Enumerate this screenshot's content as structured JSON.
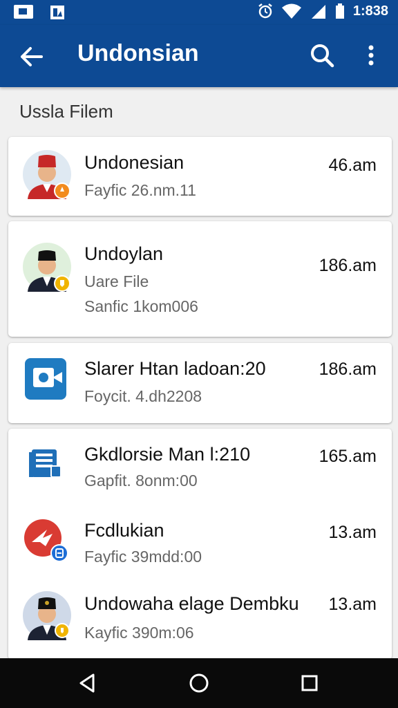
{
  "status_bar": {
    "time": "1:838",
    "icons": [
      "photo-icon",
      "gallery-icon",
      "alarm-icon",
      "wifi-icon",
      "signal-icon",
      "battery-icon"
    ]
  },
  "app_bar": {
    "title": "Undonsian",
    "icons": [
      "back-arrow-icon",
      "search-icon",
      "more-vert-icon"
    ],
    "color": "#0d4a94"
  },
  "section": {
    "header": "Ussla Filem"
  },
  "items": [
    {
      "title": "Undonesian",
      "subtitle": "Fayfic 26.nm.11",
      "time": "46.am",
      "icon": "avatar-red-cap",
      "badge_color": "#f28b1e"
    },
    {
      "title": "Undoylan",
      "subtitle": "Uare File",
      "subtitle2": "Sanfic 1kom006",
      "time": "186.am",
      "icon": "avatar-black-cap",
      "badge_color": "#f0b400"
    },
    {
      "title": "Slarer Htan ladoan:20",
      "subtitle": "Foycit. 4.dh2208",
      "time": "186.am",
      "icon": "blue-app-icon"
    },
    {
      "title": "Gkdlorsie Man l:210",
      "subtitle": "Gapfit. 8onm:00",
      "time": "165.am",
      "icon": "document-icon"
    },
    {
      "title": "Fcdlukian",
      "subtitle": "Fayfic 39mdd:00",
      "time": "13.am",
      "icon": "red-bird-icon",
      "badge_color": "#1e6ed6"
    },
    {
      "title": "Undowaha elage Dembku",
      "subtitle": "Kayfic 390m:06",
      "time": "13.am",
      "icon": "avatar-black-cap",
      "badge_color": "#f0b400"
    }
  ],
  "nav_bar": {
    "icons": [
      "back-triangle-icon",
      "home-circle-icon",
      "recents-square-icon"
    ]
  }
}
